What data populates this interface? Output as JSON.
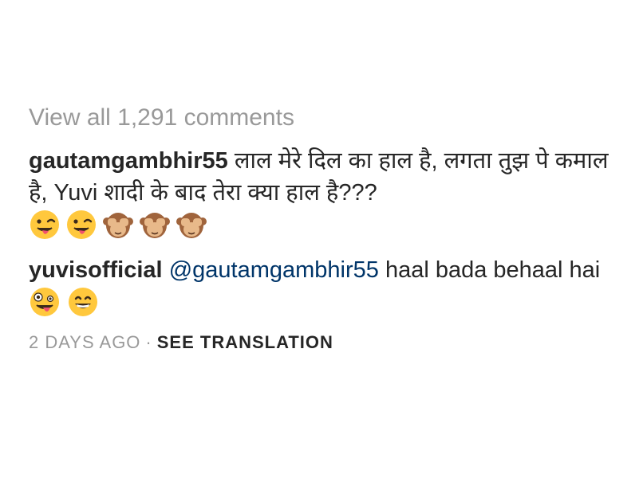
{
  "view_all_label": "View all 1,291 comments",
  "comments": [
    {
      "username": "gautamgambhir55",
      "text": "लाल मेरे दिल का हाल है, लगता तुझ पे कमाल है, Yuvi शादी के बाद तेरा क्या हाल है???",
      "emojis": [
        "winking-tongue-face-icon",
        "winking-tongue-face-icon",
        "see-no-evil-monkey-icon",
        "see-no-evil-monkey-icon",
        "see-no-evil-monkey-icon"
      ]
    },
    {
      "username": "yuvisofficial",
      "mention": "@gautamgambhir55",
      "text": "haal bada behaal hai",
      "emojis": [
        "zany-face-icon",
        "grinning-face-icon"
      ]
    }
  ],
  "meta": {
    "time": "2 DAYS AGO",
    "separator": "·",
    "translate_label": "SEE TRANSLATION"
  },
  "colors": {
    "text": "#262626",
    "muted": "#999999",
    "mention": "#003569",
    "emoji_yellow": "#FFC83D",
    "monkey_brown": "#A0643C"
  }
}
